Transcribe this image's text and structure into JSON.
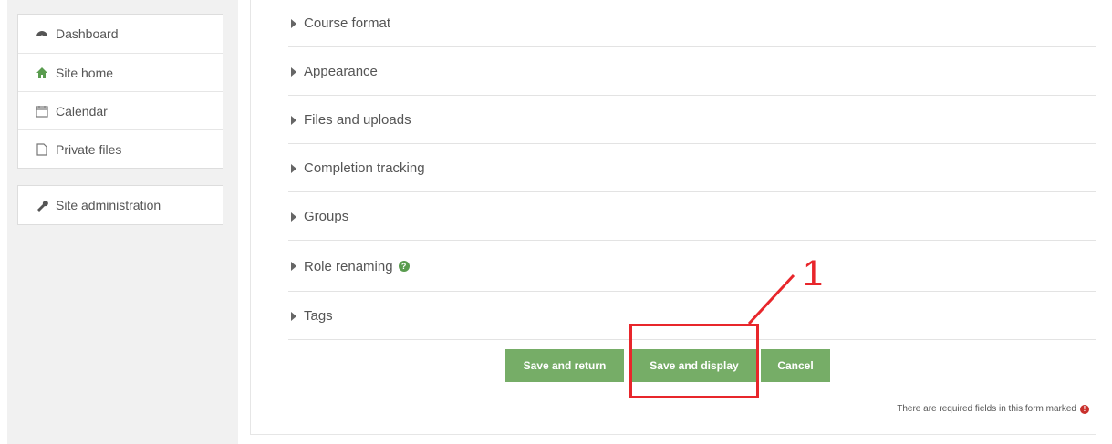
{
  "nav": {
    "items": [
      {
        "label": "Dashboard",
        "icon": "dashboard-icon"
      },
      {
        "label": "Site home",
        "icon": "home-icon"
      },
      {
        "label": "Calendar",
        "icon": "calendar-icon"
      },
      {
        "label": "Private files",
        "icon": "file-icon"
      }
    ],
    "admin": {
      "label": "Site administration",
      "icon": "wrench-icon"
    }
  },
  "sections": [
    {
      "label": "Course format"
    },
    {
      "label": "Appearance"
    },
    {
      "label": "Files and uploads"
    },
    {
      "label": "Completion tracking"
    },
    {
      "label": "Groups"
    },
    {
      "label": "Role renaming",
      "help": true
    },
    {
      "label": "Tags"
    }
  ],
  "buttons": {
    "save_return": "Save and return",
    "save_display": "Save and display",
    "cancel": "Cancel"
  },
  "required_note": "There are required fields in this form marked",
  "annotation": {
    "number": "1",
    "color": "#e8262b"
  },
  "colors": {
    "button": "#76ad67",
    "sidebar_bg": "#f1f1f1",
    "help_icon": "#5a9c4f"
  }
}
